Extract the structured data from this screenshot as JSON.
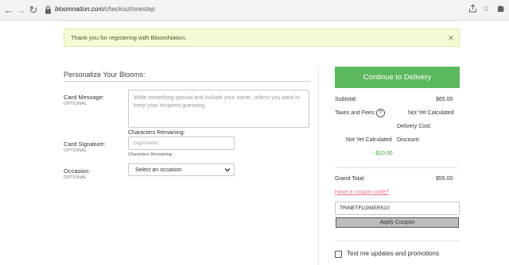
{
  "browser": {
    "url_host": "bloomnation.com",
    "url_path": "/checkout/onestep",
    "icons": [
      "back-icon",
      "forward-icon",
      "reload-icon",
      "lock-icon",
      "share-icon",
      "star-icon",
      "puzzle-icon"
    ]
  },
  "alert": {
    "message": "Thank you for registering with BloomNation.",
    "close": "×"
  },
  "personalize": {
    "title": "Personalize Your Blooms:",
    "card_message": {
      "label": "Card Message:",
      "optional": "OPTIONAL",
      "placeholder": "Write something special and include your name, unless you want to keep your recipient guessing.",
      "chars_remaining": "Characters Remaining:"
    },
    "card_signature": {
      "label": "Card Signature:",
      "optional": "OPTIONAL",
      "placeholder": "(sign here)",
      "chars_remaining": "Characters Remaining:"
    },
    "occasion": {
      "label": "Occasion:",
      "optional": "OPTIONAL",
      "selected": "Select an occasion"
    }
  },
  "summary": {
    "cta": "Continue to Delivery",
    "subtotal_label": "Subtotal:",
    "subtotal_value": "$65.00",
    "taxes_label": "Taxes and Fees:",
    "taxes_value": "Not Yet Calculated",
    "delivery_label": "Delivery Cost:",
    "delivery_value": "Not Yet Calculated",
    "discount_label": "Discount:",
    "discount_value": "- $10.00",
    "grand_total_label": "Grand Total:",
    "grand_total_value": "$55.00",
    "coupon_link": "Have a coupon code?",
    "coupon_value": "TRINETFLOWERS10",
    "apply_label": "Apply Coupon",
    "sms_label": "Text me updates and promotions"
  },
  "colors": {
    "accent_green": "#5cb85c",
    "alert_bg": "#f3fbd4",
    "coupon_link": "#e0748c",
    "discount": "#3aa03a"
  }
}
